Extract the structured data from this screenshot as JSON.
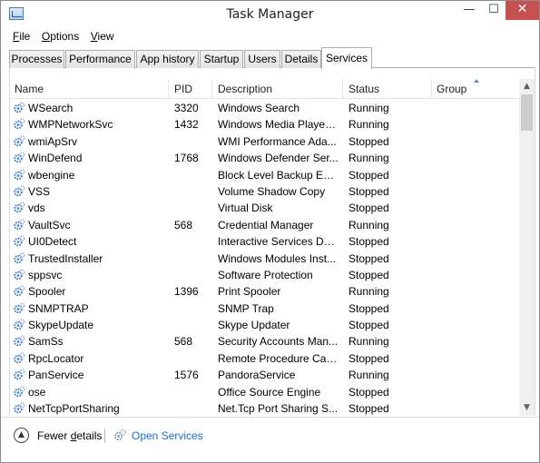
{
  "window": {
    "title": "Task Manager",
    "minimize_glyph": "—",
    "maximize_glyph": "☐",
    "close_glyph": "✕"
  },
  "menu": [
    {
      "accel": "F",
      "rest": "ile"
    },
    {
      "accel": "O",
      "rest": "ptions"
    },
    {
      "accel": "V",
      "rest": "iew"
    }
  ],
  "tabs": [
    {
      "label": "Processes",
      "active": false
    },
    {
      "label": "Performance",
      "active": false
    },
    {
      "label": "App history",
      "active": false
    },
    {
      "label": "Startup",
      "active": false
    },
    {
      "label": "Users",
      "active": false
    },
    {
      "label": "Details",
      "active": false
    },
    {
      "label": "Services",
      "active": true
    }
  ],
  "columns": {
    "name": "Name",
    "pid": "PID",
    "description": "Description",
    "status": "Status",
    "group": "Group"
  },
  "services": [
    {
      "name": "WSearch",
      "pid": "3320",
      "description": "Windows Search",
      "status": "Running",
      "group": ""
    },
    {
      "name": "WMPNetworkSvc",
      "pid": "1432",
      "description": "Windows Media Player ...",
      "status": "Running",
      "group": ""
    },
    {
      "name": "wmiApSrv",
      "pid": "",
      "description": "WMI Performance Ada...",
      "status": "Stopped",
      "group": ""
    },
    {
      "name": "WinDefend",
      "pid": "1768",
      "description": "Windows Defender Ser...",
      "status": "Running",
      "group": ""
    },
    {
      "name": "wbengine",
      "pid": "",
      "description": "Block Level Backup Eng...",
      "status": "Stopped",
      "group": ""
    },
    {
      "name": "VSS",
      "pid": "",
      "description": "Volume Shadow Copy",
      "status": "Stopped",
      "group": ""
    },
    {
      "name": "vds",
      "pid": "",
      "description": "Virtual Disk",
      "status": "Stopped",
      "group": ""
    },
    {
      "name": "VaultSvc",
      "pid": "568",
      "description": "Credential Manager",
      "status": "Running",
      "group": ""
    },
    {
      "name": "UI0Detect",
      "pid": "",
      "description": "Interactive Services Det...",
      "status": "Stopped",
      "group": ""
    },
    {
      "name": "TrustedInstaller",
      "pid": "",
      "description": "Windows Modules Inst...",
      "status": "Stopped",
      "group": ""
    },
    {
      "name": "sppsvc",
      "pid": "",
      "description": "Software Protection",
      "status": "Stopped",
      "group": ""
    },
    {
      "name": "Spooler",
      "pid": "1396",
      "description": "Print Spooler",
      "status": "Running",
      "group": ""
    },
    {
      "name": "SNMPTRAP",
      "pid": "",
      "description": "SNMP Trap",
      "status": "Stopped",
      "group": ""
    },
    {
      "name": "SkypeUpdate",
      "pid": "",
      "description": "Skype Updater",
      "status": "Stopped",
      "group": ""
    },
    {
      "name": "SamSs",
      "pid": "568",
      "description": "Security Accounts Man...",
      "status": "Running",
      "group": ""
    },
    {
      "name": "RpcLocator",
      "pid": "",
      "description": "Remote Procedure Call ...",
      "status": "Stopped",
      "group": ""
    },
    {
      "name": "PanService",
      "pid": "1576",
      "description": "PandoraService",
      "status": "Running",
      "group": ""
    },
    {
      "name": "ose",
      "pid": "",
      "description": "Office  Source Engine",
      "status": "Stopped",
      "group": ""
    },
    {
      "name": "NetTcpPortSharing",
      "pid": "",
      "description": "Net.Tcp Port Sharing S...",
      "status": "Stopped",
      "group": ""
    }
  ],
  "footer": {
    "fewer_details_accel": "d",
    "fewer_details_before": "Fewer ",
    "fewer_details_after": "etails",
    "open_services": "Open Services"
  },
  "colors": {
    "link": "#1e6cc7",
    "close_button": "#c75050",
    "gear": "#4f86c6"
  }
}
